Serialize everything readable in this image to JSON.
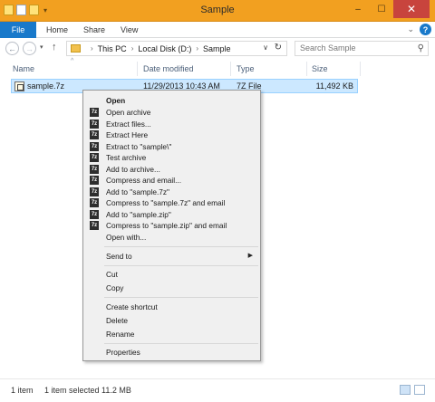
{
  "window": {
    "title": "Sample",
    "controls": {
      "minimize": "–",
      "maximize": "☐",
      "close": "✕"
    },
    "quick_access_icons": [
      "folder-icon",
      "properties-icon",
      "new-folder-icon"
    ]
  },
  "ribbon": {
    "tabs": [
      "File",
      "Home",
      "Share",
      "View"
    ],
    "help": "?"
  },
  "address_bar": {
    "crumbs": [
      "This PC",
      "Local Disk (D:)",
      "Sample"
    ],
    "search_placeholder": "Search Sample"
  },
  "columns": [
    "Name",
    "Date modified",
    "Type",
    "Size"
  ],
  "files": [
    {
      "name": "sample.7z",
      "date": "11/29/2013 10:43 AM",
      "type": "7Z File",
      "size": "11,492 KB",
      "selected": true
    }
  ],
  "context_menu": {
    "items": [
      {
        "label": "Open",
        "bold": true,
        "icon": ""
      },
      {
        "label": "Open archive",
        "icon": "7z"
      },
      {
        "label": "Extract files...",
        "icon": "7z"
      },
      {
        "label": "Extract Here",
        "icon": "7z"
      },
      {
        "label": "Extract to \"sample\\\"",
        "icon": "7z"
      },
      {
        "label": "Test archive",
        "icon": "7z"
      },
      {
        "label": "Add to archive...",
        "icon": "7z"
      },
      {
        "label": "Compress and email...",
        "icon": "7z"
      },
      {
        "label": "Add to \"sample.7z\"",
        "icon": "7z"
      },
      {
        "label": "Compress to \"sample.7z\" and email",
        "icon": "7z"
      },
      {
        "label": "Add to \"sample.zip\"",
        "icon": "7z"
      },
      {
        "label": "Compress to \"sample.zip\" and email",
        "icon": "7z"
      },
      {
        "label": "Open with...",
        "icon": ""
      },
      {
        "label": "Send to",
        "icon": "",
        "submenu": true
      },
      {
        "label": "Cut",
        "icon": ""
      },
      {
        "label": "Copy",
        "icon": ""
      },
      {
        "label": "Create shortcut",
        "icon": ""
      },
      {
        "label": "Delete",
        "icon": ""
      },
      {
        "label": "Rename",
        "icon": ""
      },
      {
        "label": "Properties",
        "icon": ""
      }
    ]
  },
  "status_bar": {
    "item_count": "1 item",
    "selection": "1 item selected  11.2 MB"
  },
  "colors": {
    "title_bar": "#f2a020",
    "file_tab": "#1979ca",
    "close_button": "#c8443d",
    "selection": "#cce8ff",
    "menu_background": "#f0f0f0"
  }
}
